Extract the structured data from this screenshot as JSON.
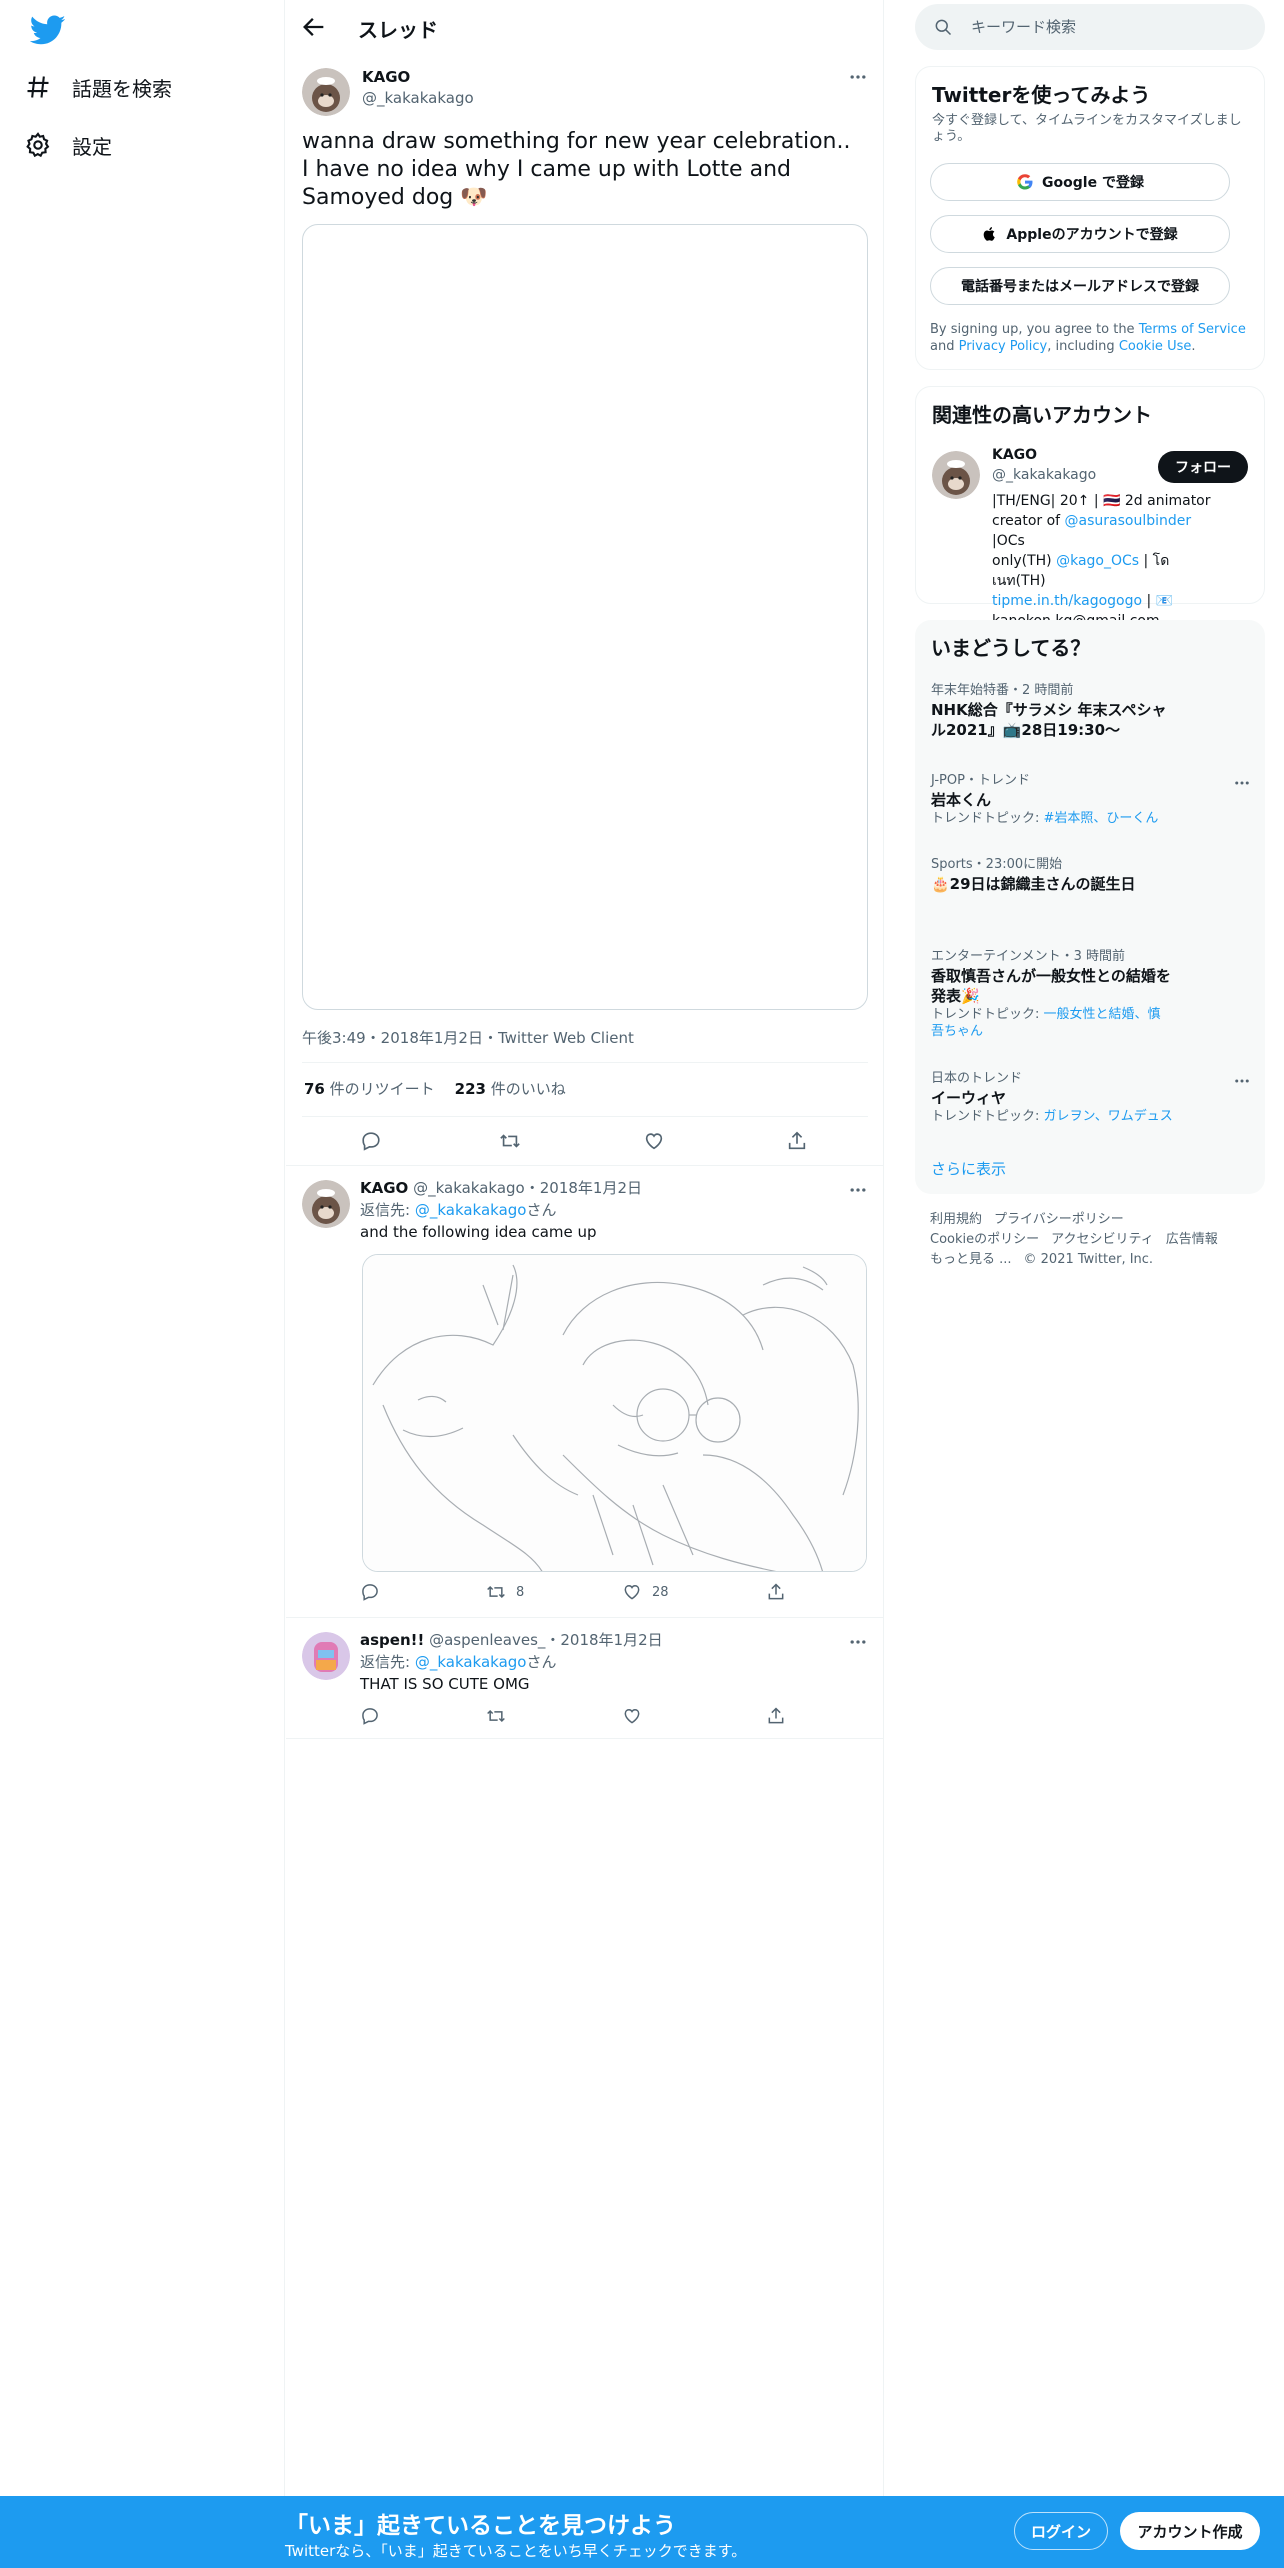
{
  "colors": {
    "accent": "#1d9bf0",
    "text": "#0f1419",
    "secondary": "#536471",
    "border": "#eff3f4"
  },
  "nav": {
    "logo_icon": "twitter-bird-icon",
    "items": [
      {
        "label": "話題を検索",
        "icon": "hashtag-icon"
      },
      {
        "label": "設定",
        "icon": "gear-icon"
      }
    ]
  },
  "header": {
    "title": "スレッド",
    "back_icon": "arrow-left-icon"
  },
  "main_tweet": {
    "name": "KAGO",
    "handle": "@_kakakakago",
    "text_line1": "wanna draw something for new year celebration..",
    "text_line2": "I have no idea why I came up with Lotte and",
    "text_line3": "Samoyed dog 🐶",
    "meta": "午後3:49・2018年1月2日・Twitter Web Client",
    "retweet_count": "76",
    "retweet_label": "件のリツイート",
    "like_count": "223",
    "like_label": "件のいいね"
  },
  "replies": [
    {
      "name": "KAGO",
      "handle_date": "@_kakakakago・2018年1月2日",
      "reply_prefix": "返信先: ",
      "reply_to": "@_kakakakago",
      "reply_suffix": "さん",
      "text": "and the following idea came up",
      "retweets": "8",
      "likes": "28"
    },
    {
      "name": "aspen!!",
      "handle_date": "@aspenleaves_・2018年1月2日",
      "reply_prefix": "返信先: ",
      "reply_to": "@_kakakakago",
      "reply_suffix": "さん",
      "text": "THAT IS SO CUTE OMG"
    }
  ],
  "search": {
    "placeholder": "キーワード検索"
  },
  "signup_card": {
    "title": "Twitterを使ってみよう",
    "subtitle": "今すぐ登録して、タイムラインをカスタマイズしましょう。",
    "google_btn": "Google で登録",
    "apple_btn": "Appleのアカウントで登録",
    "phone_btn": "電話番号またはメールアドレスで登録",
    "terms_prefix": "By signing up, you agree to the ",
    "terms_link": "Terms of Service",
    "terms_mid": " and ",
    "privacy_link": "Privacy Policy",
    "terms_mid2": ", including ",
    "cookie_link": "Cookie Use",
    "terms_end": "."
  },
  "related": {
    "title": "関連性の高いアカウント",
    "name": "KAGO",
    "handle": "@_kakakakago",
    "follow": "フォロー",
    "bio_line1": "|TH/ENG| 20↑ | 🇹🇭 2d animator",
    "bio_line2a": "creator of ",
    "bio_link1": "@asurasoulbinder",
    "bio_line2b": " |OCs",
    "bio_line3a": "only(TH) ",
    "bio_link2": "@kago_OCs",
    "bio_line3b": " | โดเนท(TH)",
    "bio_link3": "tipme.in.th/kagogogo",
    "bio_line4b": " | 📧",
    "bio_line5": "kanokon.kg@gmail.com"
  },
  "trends": {
    "title": "いまどうしてる？",
    "items": [
      {
        "meta": "年末年始特番・2 時間前",
        "title": "NHK総合『サラメシ 年末スペシャル2021』📺28日19:30〜",
        "topics_label": "",
        "topics": ""
      },
      {
        "meta": "J-POP・トレンド",
        "title": "岩本くん",
        "topics_label": "トレンドトピック: ",
        "topics": "#岩本照、ひーくん"
      },
      {
        "meta": "Sports・23:00に開始",
        "title": "🎂29日は錦織圭さんの誕生日",
        "topics_label": "",
        "topics": ""
      },
      {
        "meta": "エンターテインメント・3 時間前",
        "title": "香取慎吾さんが一般女性との結婚を発表🎉",
        "topics_label": "トレンドトピック: ",
        "topics": "一般女性と結婚、慎吾ちゃん"
      },
      {
        "meta": "日本のトレンド",
        "title": "イーウィヤ",
        "topics_label": "トレンドトピック: ",
        "topics": "ガレヲン、ワムデュス"
      }
    ],
    "show_more": "さらに表示"
  },
  "footer": {
    "links": [
      "利用規約",
      "プライバシーポリシー",
      "Cookieのポリシー",
      "アクセシビリティ",
      "広告情報",
      "もっと見る ..."
    ],
    "copyright": "© 2021 Twitter, Inc."
  },
  "bottom_bar": {
    "title": "「いま」起きていることを見つけよう",
    "subtitle": "Twitterなら、「いま」起きていることをいち早くチェックできます。",
    "login": "ログイン",
    "signup": "アカウント作成"
  }
}
